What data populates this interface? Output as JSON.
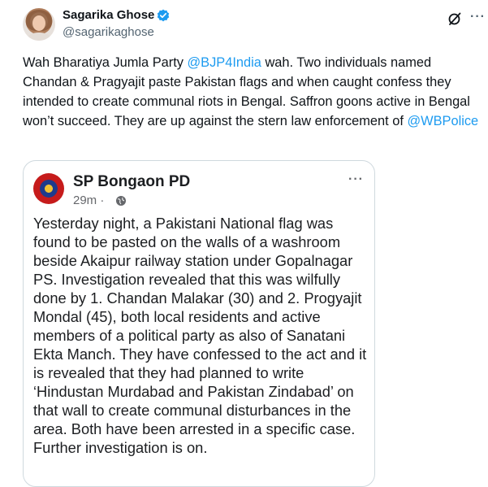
{
  "tweet": {
    "author_name": "Sagarika Ghose",
    "handle": "@sagarikaghose",
    "text_before_mention1": "Wah Bharatiya Jumla Party ",
    "mention1": "@BJP4India",
    "text_between": " wah. Two individuals named Chandan & Pragyajit paste Pakistan flags and when caught confess they intended to create communal riots in Bengal. Saffron goons active in Bengal won’t succeed. They are up against the stern law enforcement of ",
    "mention2": "@WBPolice"
  },
  "embed": {
    "page_name": "SP Bongaon PD",
    "time": "29m ·",
    "text": "Yesterday night, a Pakistani National flag was found to be pasted on the walls of a washroom beside Akaipur railway station under Gopalnagar PS. Investigation revealed that this was wilfully done by 1. Chandan Malakar (30) and 2. Progyajit Mondal (45), both local residents and active members of a political party as also of Sanatani Ekta Manch. They have confessed to the act and it is revealed that they had planned to write ‘Hindustan Murdabad and Pakistan Zindabad’ on that wall to create communal disturbances in the area. Both have been arrested in a specific case. Further investigation is on."
  },
  "icons": {
    "verified": "verified-badge-icon",
    "grok": "grok-icon",
    "more": "more-options-icon",
    "globe": "globe-icon"
  },
  "colors": {
    "link": "#1d9bf0",
    "secondary_text": "#536471",
    "card_border": "#cfd9de"
  }
}
